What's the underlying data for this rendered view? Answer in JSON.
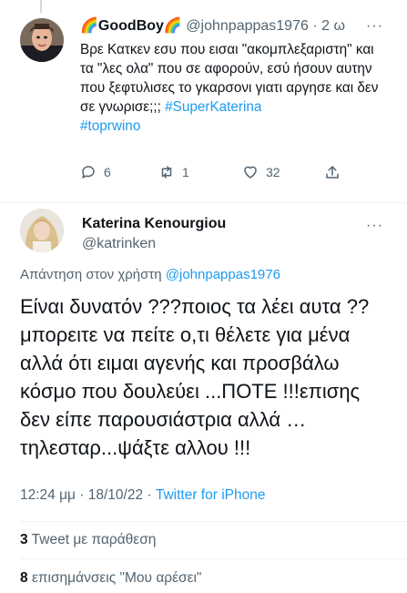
{
  "tweet1": {
    "display_name": "🌈GoodBoy🌈",
    "handle": "@johnpappas1976",
    "separator": "·",
    "time": "2 ω",
    "text": "Βρε Κατκεν εσυ που εισαι \"ακομπλεξαριστη\" και τα \"λες ολα\" που σε αφορούν, εσύ ήσουν αυτην που ξεφτυλισες το γκαρσονι γιατι αργησε και δεν σε γνωρισε;;; ",
    "hashtag1": "#SuperKaterina",
    "hashtag2": "#toprwino",
    "more": "···",
    "reply_count": "6",
    "retweet_count": "1",
    "like_count": "32"
  },
  "tweet2": {
    "display_name": "Katerina Kenourgiou",
    "handle": "@katrinken",
    "more": "···",
    "reply_label": "Απάντηση στον χρήστη",
    "reply_handle": "@johnpappas1976",
    "text": "Είναι δυνατόν ???ποιος τα λέει αυτα ?? μπορειτε να πείτε ο,τι θέλετε για μένα αλλά ότι ειμαι αγενής και προσβάλω κόσμο που δουλεύει ...ΠΟΤΕ !!!επισης δεν είπε παρουσιάστρια αλλά … τηλεσταρ...ψάξτε αλλου !!!",
    "timestamp": "12:24 μμ · 18/10/22 · ",
    "source": "Twitter for iPhone",
    "quote_count": "3",
    "quote_label": "Tweet με παράθεση",
    "likes_count": "8",
    "likes_label": "επισημάνσεις \"Μου αρέσει\""
  }
}
